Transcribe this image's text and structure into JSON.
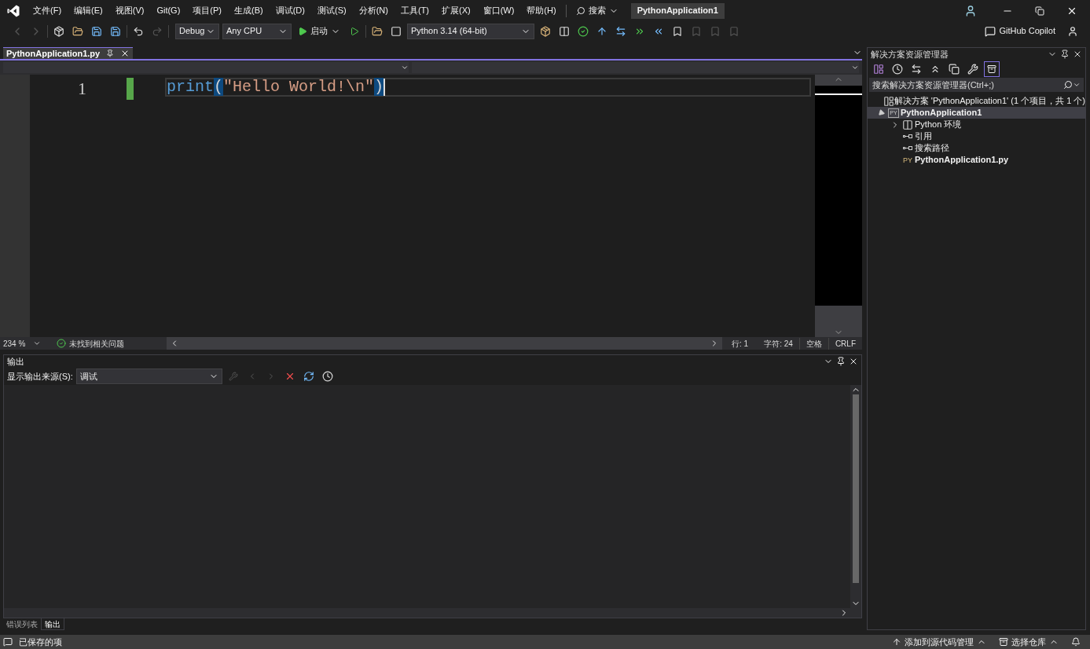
{
  "menu": [
    "文件(F)",
    "编辑(E)",
    "视图(V)",
    "Git(G)",
    "项目(P)",
    "生成(B)",
    "调试(D)",
    "测试(S)",
    "分析(N)",
    "工具(T)",
    "扩展(X)",
    "窗口(W)",
    "帮助(H)"
  ],
  "search": {
    "label": "搜索"
  },
  "window": {
    "title": "PythonApplication1"
  },
  "toolbar": {
    "configuration": "Debug",
    "platform": "Any CPU",
    "start": "启动",
    "environment": "Python 3.14 (64-bit)",
    "copilot": "GitHub Copilot"
  },
  "editor_tabs": [
    {
      "label": "PythonApplication1.py",
      "selected": true
    }
  ],
  "editor": {
    "line_numbers": [
      "1"
    ],
    "tokens": [
      {
        "kind": "function",
        "text": "print",
        "highlighted": false
      },
      {
        "kind": "paren",
        "text": "(",
        "highlighted": true
      },
      {
        "kind": "string",
        "text": "\"Hello World!\\n\"",
        "highlighted": false
      },
      {
        "kind": "paren",
        "text": ")",
        "highlighted": true
      }
    ]
  },
  "editor_status": {
    "zoom": "234 %",
    "issues": "未找到相关问题",
    "line": "行: 1",
    "char": "字符: 24",
    "whitespace": "空格",
    "line_ending": "CRLF"
  },
  "output": {
    "title": "输出",
    "source_label": "显示输出来源(S):",
    "source": "调试"
  },
  "bottom_tabs": [
    {
      "label": "错误列表",
      "selected": false
    },
    {
      "label": "输出",
      "selected": true
    }
  ],
  "solution_explorer": {
    "title": "解决方案资源管理器",
    "search_placeholder": "搜索解决方案资源管理器(Ctrl+;)",
    "tree": [
      {
        "kind": "solution",
        "label": "解决方案 'PythonApplication1' (1 个项目，共 1 个)",
        "selected": false
      },
      {
        "kind": "project",
        "icon_text": "PY",
        "label": "PythonApplication1",
        "selected": true,
        "expanded": true,
        "children": [
          {
            "kind": "environment",
            "label": "Python 环境",
            "selected": false,
            "expanded": false
          },
          {
            "kind": "reference",
            "label": "引用",
            "selected": false
          },
          {
            "kind": "reference",
            "label": "搜索路径",
            "selected": false
          },
          {
            "kind": "file",
            "icon_text": "PY",
            "label": "PythonApplication1.py",
            "selected": false
          }
        ]
      }
    ]
  },
  "status_bar": {
    "message": "已保存的项",
    "source_control": "添加到源代码管理",
    "repository": "选择仓库"
  }
}
